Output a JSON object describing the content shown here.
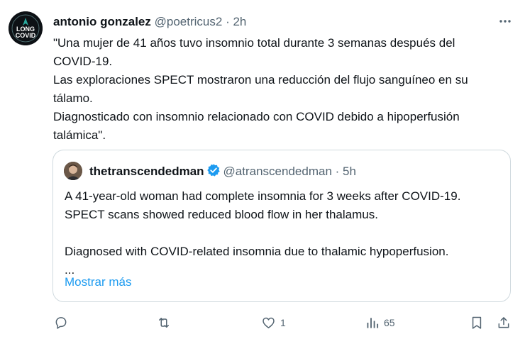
{
  "author": {
    "name": "antonio gonzalez",
    "handle": "@poetricus2",
    "separator": "·",
    "time": "2h",
    "avatar_text_top": "LONG",
    "avatar_text_bottom": "COVID"
  },
  "tweet_lines": [
    "\"Una mujer de 41 años tuvo insomnio total durante 3 semanas después del",
    "COVID-19.",
    "Las exploraciones SPECT mostraron una reducción del flujo sanguíneo en su",
    "tálamo.",
    "Diagnosticado con insomnio relacionado con COVID debido a hipoperfusión",
    "talámica\"."
  ],
  "quote": {
    "name": "thetranscendedman",
    "handle": "@atranscendedman",
    "separator": "·",
    "time": "5h",
    "lines": [
      "A 41-year-old woman had complete insomnia for 3 weeks after COVID-19.",
      "SPECT scans showed reduced blood flow in her thalamus.",
      "",
      "Diagnosed with COVID-related insomnia due to thalamic hypoperfusion.",
      "..."
    ],
    "show_more": "Mostrar más"
  },
  "actions": {
    "reply_icon": "reply-icon",
    "retweet_icon": "retweet-icon",
    "like_icon": "heart-icon",
    "like_count": "1",
    "views_icon": "views-icon",
    "views_count": "65",
    "bookmark_icon": "bookmark-icon",
    "share_icon": "share-icon"
  },
  "colors": {
    "text": "#0f1419",
    "secondary": "#536471",
    "link": "#1d9bf0",
    "border": "#cfd9de",
    "verified": "#1d9bf0"
  }
}
